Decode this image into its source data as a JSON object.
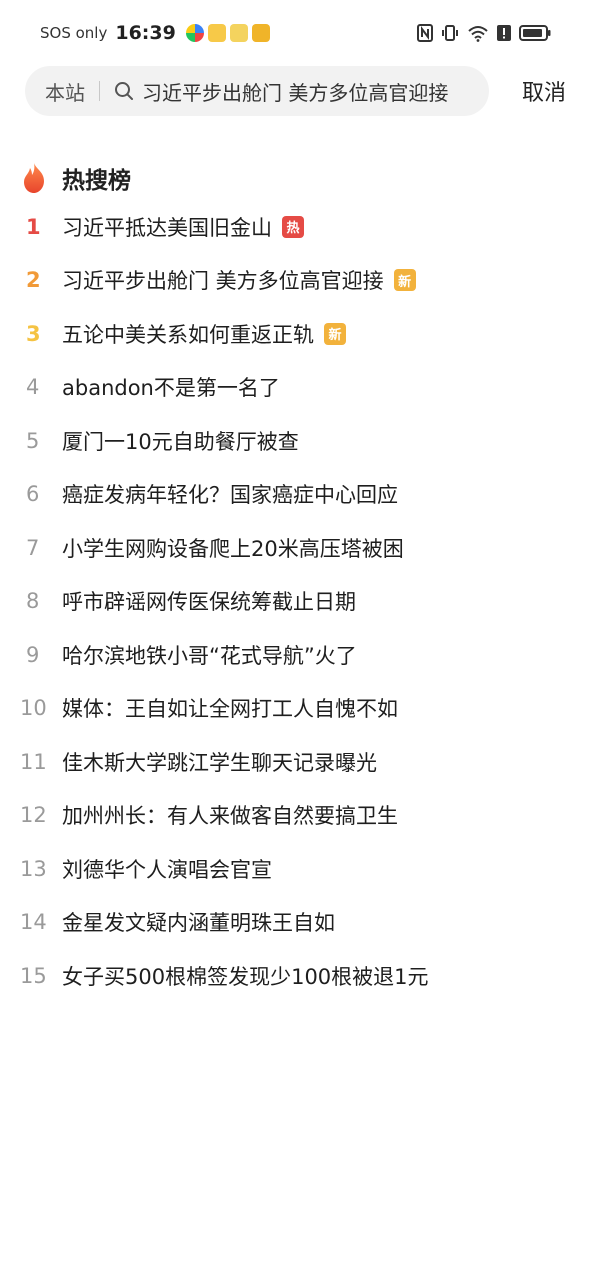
{
  "status_bar": {
    "carrier": "SOS only",
    "time": "16:39"
  },
  "search": {
    "scope": "本站",
    "query": "习近平步出舱门 美方多位高官迎接",
    "cancel_label": "取消"
  },
  "hot_list": {
    "title": "热搜榜",
    "items": [
      {
        "rank": "1",
        "text": "习近平抵达美国旧金山",
        "tag": "热"
      },
      {
        "rank": "2",
        "text": "习近平步出舱门 美方多位高官迎接",
        "tag": "新"
      },
      {
        "rank": "3",
        "text": "五论中美关系如何重返正轨",
        "tag": "新"
      },
      {
        "rank": "4",
        "text": "abandon不是第一名了",
        "tag": ""
      },
      {
        "rank": "5",
        "text": "厦门一10元自助餐厅被查",
        "tag": ""
      },
      {
        "rank": "6",
        "text": "癌症发病年轻化？国家癌症中心回应",
        "tag": ""
      },
      {
        "rank": "7",
        "text": "小学生网购设备爬上20米高压塔被困",
        "tag": ""
      },
      {
        "rank": "8",
        "text": "呼市辟谣网传医保统筹截止日期",
        "tag": ""
      },
      {
        "rank": "9",
        "text": "哈尔滨地铁小哥“花式导航”火了",
        "tag": ""
      },
      {
        "rank": "10",
        "text": "媒体：王自如让全网打工人自愧不如",
        "tag": ""
      },
      {
        "rank": "11",
        "text": "佳木斯大学跳江学生聊天记录曝光",
        "tag": ""
      },
      {
        "rank": "12",
        "text": "加州州长：有人来做客自然要搞卫生",
        "tag": ""
      },
      {
        "rank": "13",
        "text": "刘德华个人演唱会官宣",
        "tag": ""
      },
      {
        "rank": "14",
        "text": "金星发文疑内涵董明珠王自如",
        "tag": ""
      },
      {
        "rank": "15",
        "text": "女子买500根棉签发现少100根被退1元",
        "tag": ""
      }
    ]
  },
  "colors": {
    "rank1": "#e54b45",
    "rank2": "#f19a38",
    "rank3": "#f5c343",
    "tag_hot": "#e54b45",
    "tag_new": "#f2b23c"
  }
}
